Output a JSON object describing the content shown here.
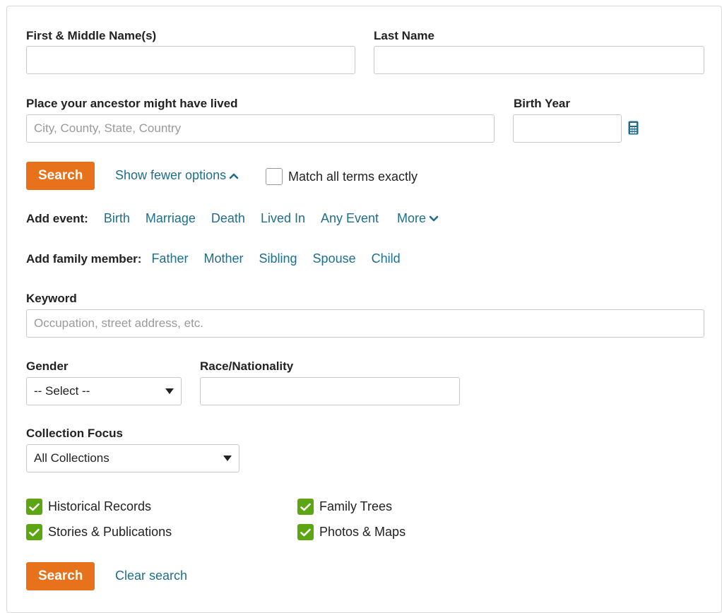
{
  "names": {
    "first_label": "First & Middle Name(s)",
    "first_value": "",
    "last_label": "Last Name",
    "last_value": ""
  },
  "place": {
    "label": "Place your ancestor might have lived",
    "placeholder": "City, County, State, Country",
    "value": ""
  },
  "birth": {
    "label": "Birth Year",
    "value": "",
    "icon": "calculator-icon"
  },
  "actions": {
    "search_label": "Search",
    "show_fewer_label": "Show fewer options",
    "match_exact_label": "Match all terms exactly",
    "match_exact_checked": false
  },
  "events": {
    "label": "Add event:",
    "items": [
      "Birth",
      "Marriage",
      "Death",
      "Lived In",
      "Any Event"
    ],
    "more_label": "More"
  },
  "family": {
    "label": "Add family member:",
    "items": [
      "Father",
      "Mother",
      "Sibling",
      "Spouse",
      "Child"
    ]
  },
  "keyword": {
    "label": "Keyword",
    "placeholder": "Occupation, street address, etc.",
    "value": ""
  },
  "gender": {
    "label": "Gender",
    "selected": "-- Select --"
  },
  "race": {
    "label": "Race/Nationality",
    "value": ""
  },
  "collection": {
    "label": "Collection Focus",
    "selected": "All Collections"
  },
  "filters": [
    {
      "label": "Historical Records",
      "checked": true
    },
    {
      "label": "Family Trees",
      "checked": true
    },
    {
      "label": "Stories & Publications",
      "checked": true
    },
    {
      "label": "Photos & Maps",
      "checked": true
    }
  ],
  "footer": {
    "search_label": "Search",
    "clear_label": "Clear search"
  },
  "colors": {
    "accent_orange": "#e8711c",
    "link_blue": "#1f6e8c",
    "check_green": "#5ca513"
  }
}
